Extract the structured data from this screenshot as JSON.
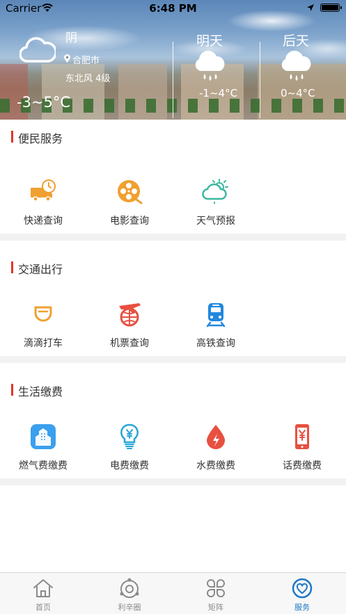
{
  "status_bar": {
    "carrier": "Carrier",
    "time": "6:48 PM"
  },
  "weather": {
    "today": {
      "condition": "阴",
      "city": "合肥市",
      "wind": "东北风 4级",
      "temp": "-3~5°C",
      "icon": "cloud-icon"
    },
    "tomorrow": {
      "label": "明天",
      "temp": "-1~4°C",
      "icon": "rain-cloud-icon"
    },
    "day_after": {
      "label": "后天",
      "temp": "0~4°C",
      "icon": "rain-cloud-icon"
    }
  },
  "sections": {
    "convenience": {
      "title": "便民服务",
      "items": [
        {
          "label": "快递查询",
          "icon": "delivery-truck-icon",
          "color": "#f0a030"
        },
        {
          "label": "电影查询",
          "icon": "film-reel-icon",
          "color": "#f0a030"
        },
        {
          "label": "天气预报",
          "icon": "weather-icon",
          "color": "#3cb8a0"
        }
      ]
    },
    "transport": {
      "title": "交通出行",
      "items": [
        {
          "label": "滴滴打车",
          "icon": "didi-cup-icon",
          "color": "#f0a030"
        },
        {
          "label": "机票查询",
          "icon": "plane-globe-icon",
          "color": "#e85040"
        },
        {
          "label": "高铁查询",
          "icon": "train-icon",
          "color": "#2288dd"
        }
      ]
    },
    "bills": {
      "title": "生活缴费",
      "items": [
        {
          "label": "燃气费缴费",
          "icon": "gas-building-icon",
          "color": "#3aa0ee"
        },
        {
          "label": "电费缴费",
          "icon": "lightbulb-yen-icon",
          "color": "#28a6d8"
        },
        {
          "label": "水费缴费",
          "icon": "water-drop-icon",
          "color": "#e85040"
        },
        {
          "label": "话费缴费",
          "icon": "phone-yen-icon",
          "color": "#e85040"
        }
      ]
    }
  },
  "tabbar": {
    "tabs": [
      {
        "label": "首页",
        "icon": "home-icon"
      },
      {
        "label": "利辛圈",
        "icon": "circle-icon"
      },
      {
        "label": "矩阵",
        "icon": "grid-icon"
      },
      {
        "label": "服务",
        "icon": "heart-service-icon",
        "active": true
      }
    ]
  },
  "colors": {
    "accent_bar": "#e0352b",
    "active_tab": "#1e78c8",
    "inactive_tab": "#8a8a8a"
  }
}
